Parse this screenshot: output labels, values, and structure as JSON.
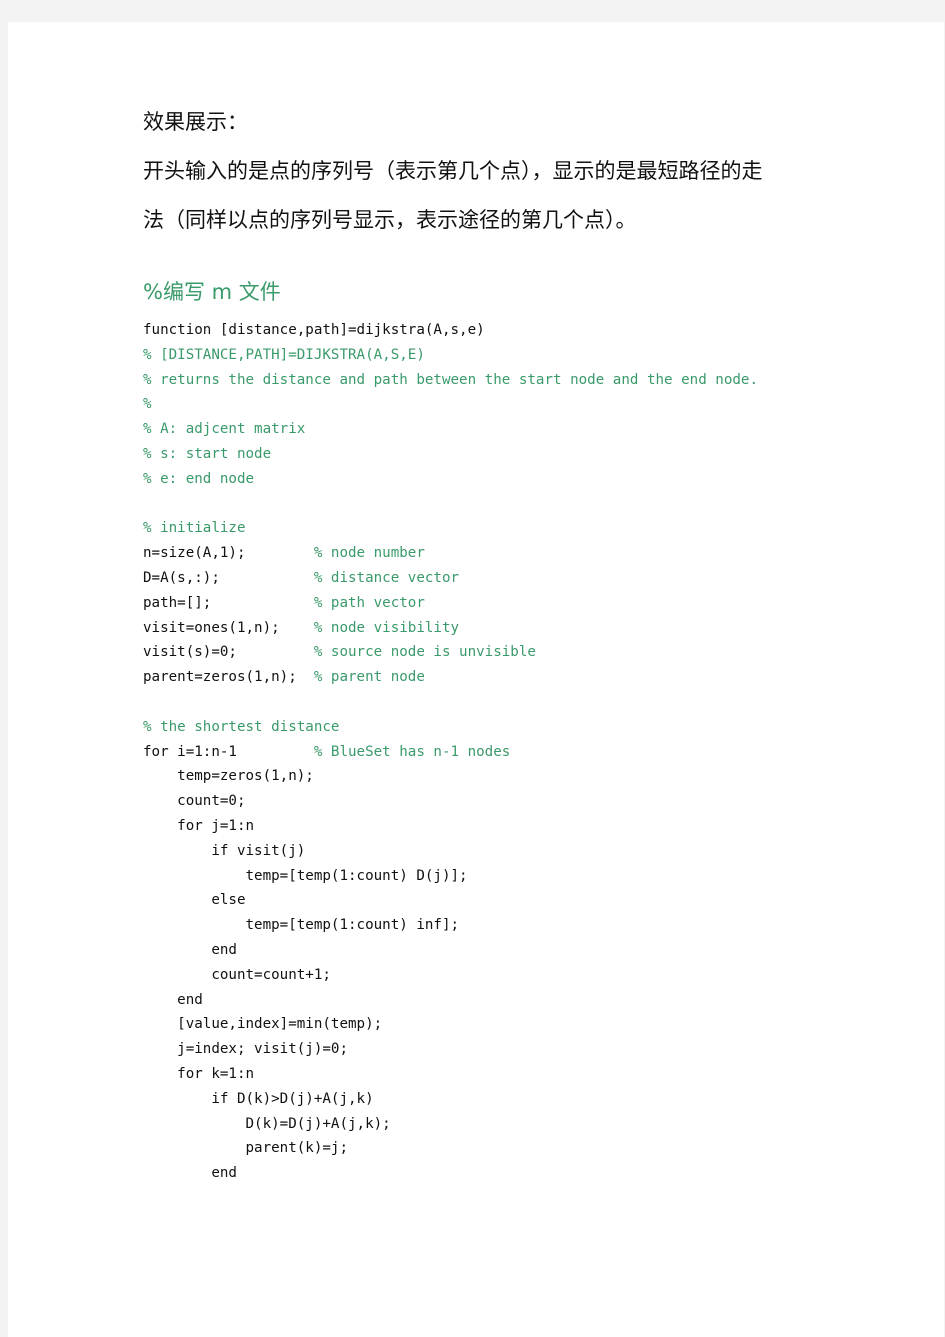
{
  "document": {
    "heading": "效果展示：",
    "paragraph": [
      "开头输入的是点的序列号（表示第几个点），显示的是最短路径的走",
      "法（同样以点的序列号显示，表示途径的第几个点）。"
    ],
    "section_title": "%编写 m 文件",
    "colors": {
      "comment": "#3a9a6a",
      "text": "#111111",
      "page_background": "#f3f3f3",
      "sheet": "#ffffff"
    },
    "code_lines": [
      {
        "code": "function [distance,path]=dijkstra(A,s,e)",
        "comment": ""
      },
      {
        "code": "",
        "comment": "% [DISTANCE,PATH]=DIJKSTRA(A,S,E)"
      },
      {
        "code": "",
        "comment": "% returns the distance and path between the start node and the end node."
      },
      {
        "code": "",
        "comment": "%"
      },
      {
        "code": "",
        "comment": "% A: adjcent matrix"
      },
      {
        "code": "",
        "comment": "% s: start node"
      },
      {
        "code": "",
        "comment": "% e: end node"
      },
      {
        "code": "",
        "comment": ""
      },
      {
        "code": "",
        "comment": "% initialize"
      },
      {
        "code": "n=size(A,1);        ",
        "comment": "% node number"
      },
      {
        "code": "D=A(s,:);           ",
        "comment": "% distance vector"
      },
      {
        "code": "path=[];            ",
        "comment": "% path vector"
      },
      {
        "code": "visit=ones(1,n);    ",
        "comment": "% node visibility"
      },
      {
        "code": "visit(s)=0;         ",
        "comment": "% source node is unvisible"
      },
      {
        "code": "parent=zeros(1,n);  ",
        "comment": "% parent node"
      },
      {
        "code": "",
        "comment": ""
      },
      {
        "code": "",
        "comment": "% the shortest distance"
      },
      {
        "code": "for i=1:n-1         ",
        "comment": "% BlueSet has n-1 nodes"
      },
      {
        "code": "    temp=zeros(1,n);",
        "comment": ""
      },
      {
        "code": "    count=0;",
        "comment": ""
      },
      {
        "code": "    for j=1:n",
        "comment": ""
      },
      {
        "code": "        if visit(j)",
        "comment": ""
      },
      {
        "code": "            temp=[temp(1:count) D(j)];",
        "comment": ""
      },
      {
        "code": "        else",
        "comment": ""
      },
      {
        "code": "            temp=[temp(1:count) inf];",
        "comment": ""
      },
      {
        "code": "        end",
        "comment": ""
      },
      {
        "code": "        count=count+1;",
        "comment": ""
      },
      {
        "code": "    end",
        "comment": ""
      },
      {
        "code": "    [value,index]=min(temp);",
        "comment": ""
      },
      {
        "code": "    j=index; visit(j)=0;",
        "comment": ""
      },
      {
        "code": "    for k=1:n",
        "comment": ""
      },
      {
        "code": "        if D(k)>D(j)+A(j,k)",
        "comment": ""
      },
      {
        "code": "            D(k)=D(j)+A(j,k);",
        "comment": ""
      },
      {
        "code": "            parent(k)=j;",
        "comment": ""
      },
      {
        "code": "        end",
        "comment": ""
      }
    ]
  }
}
